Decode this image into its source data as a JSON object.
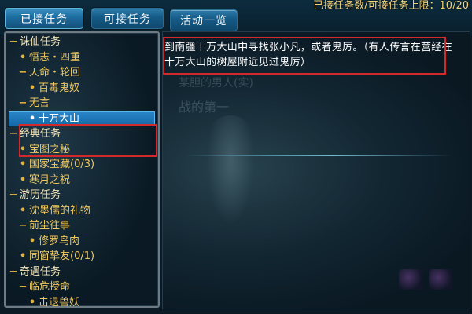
{
  "header": {
    "tabs": [
      {
        "label": "已接任务"
      },
      {
        "label": "可接任务"
      },
      {
        "label": "活动一览"
      }
    ],
    "quest_count_text": "已接任务数/可接任务上限：10/20"
  },
  "quest_list": [
    {
      "level": 0,
      "mark": "−",
      "label": "诛仙任务"
    },
    {
      "level": 1,
      "mark": "•",
      "label": "悟志・四重"
    },
    {
      "level": 1,
      "mark": "−",
      "label": "天命・轮回"
    },
    {
      "level": 2,
      "mark": "•",
      "label": "百毒鬼奴"
    },
    {
      "level": 1,
      "mark": "−",
      "label": "无言"
    },
    {
      "level": 2,
      "mark": "•",
      "label": "十万大山",
      "selected": true
    },
    {
      "level": 0,
      "mark": "−",
      "label": "经典任务"
    },
    {
      "level": 1,
      "mark": "•",
      "label": "宝图之秘"
    },
    {
      "level": 1,
      "mark": "•",
      "label": "国家宝藏(0/3)"
    },
    {
      "level": 1,
      "mark": "•",
      "label": "寒月之祝"
    },
    {
      "level": 0,
      "mark": "−",
      "label": "游历任务"
    },
    {
      "level": 1,
      "mark": "•",
      "label": "沈墨儒的礼物"
    },
    {
      "level": 1,
      "mark": "−",
      "label": "前尘往事"
    },
    {
      "level": 2,
      "mark": "•",
      "label": "修罗鸟肉"
    },
    {
      "level": 1,
      "mark": "•",
      "label": "同窗挚友(0/1)"
    },
    {
      "level": 0,
      "mark": "−",
      "label": "奇遇任务"
    },
    {
      "level": 1,
      "mark": "−",
      "label": "临危授命"
    },
    {
      "level": 2,
      "mark": "•",
      "label": "击退兽妖"
    }
  ],
  "description": {
    "text": "到南疆十万大山中寻找张小凡，或者鬼厉。（有人传言在营经在十万大山的树屋附近见过鬼厉）"
  },
  "scene": {
    "faded_line_1": "某胆的男人(实)",
    "faded_line_2": "战的第一"
  },
  "colors": {
    "highlight_box": "#d22a2a",
    "selected_row": "#1467a6",
    "category_text": "#f4e6b8",
    "quest_text": "#f0c85e",
    "counter_text": "#f0d27a"
  }
}
